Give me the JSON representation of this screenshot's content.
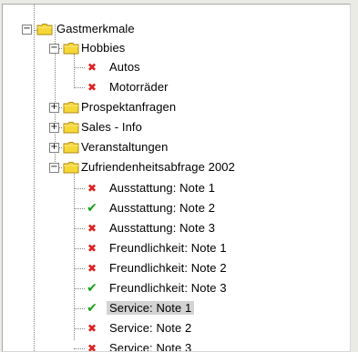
{
  "tree": {
    "root": {
      "label": "Gastmerkmale",
      "expander": "−",
      "icon": "folder-icon"
    },
    "hobbies": {
      "label": "Hobbies",
      "expander": "−",
      "icon": "folder-icon",
      "children": [
        {
          "label": "Autos",
          "status": "x",
          "status_icon": "cross-icon"
        },
        {
          "label": "Motorräder",
          "status": "x",
          "status_icon": "cross-icon"
        }
      ]
    },
    "collapsed_groups": [
      {
        "label": "Prospektanfragen",
        "expander": "+",
        "icon": "folder-icon"
      },
      {
        "label": "Sales - Info",
        "expander": "+",
        "icon": "folder-icon"
      },
      {
        "label": "Veranstaltungen",
        "expander": "+",
        "icon": "folder-icon"
      }
    ],
    "zufriedenheit": {
      "label": "Zufriendenheitsabfrage 2002",
      "expander": "−",
      "icon": "folder-icon",
      "children": [
        {
          "label": "Ausstattung: Note 1",
          "status": "x"
        },
        {
          "label": "Ausstattung: Note 2",
          "status": "check"
        },
        {
          "label": "Ausstattung: Note 3",
          "status": "x"
        },
        {
          "label": "Freundlichkeit: Note 1",
          "status": "x"
        },
        {
          "label": "Freundlichkeit: Note 2",
          "status": "x"
        },
        {
          "label": "Freundlichkeit: Note 3",
          "status": "check"
        },
        {
          "label": "Service: Note 1",
          "status": "check",
          "selected": true
        },
        {
          "label": "Service: Note 2",
          "status": "x"
        },
        {
          "label": "Service: Note 3",
          "status": "x"
        }
      ]
    }
  },
  "glyphs": {
    "x": "✖",
    "check": "✔"
  },
  "colors": {
    "folder_fill": "#f5d838",
    "folder_stroke": "#b08a10",
    "cross": "#e02020",
    "check": "#18a018",
    "selection": "#d3d3d3"
  }
}
